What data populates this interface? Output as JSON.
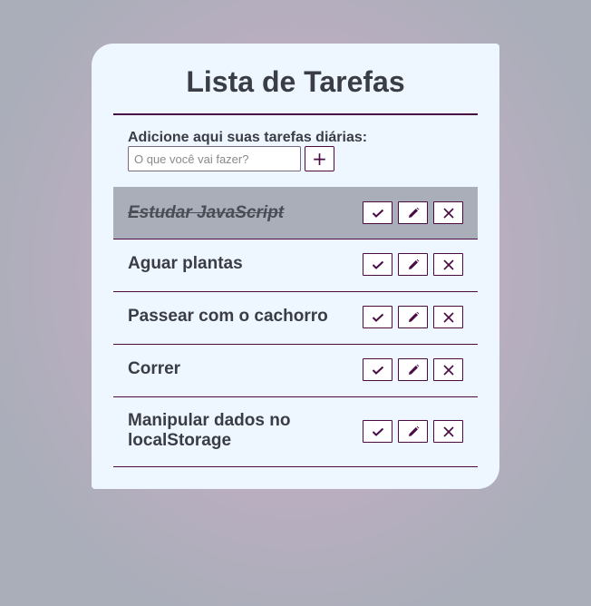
{
  "app": {
    "title": "Lista de Tarefas"
  },
  "form": {
    "label": "Adicione aqui suas tarefas diárias:",
    "input_placeholder": "O que você vai fazer?",
    "input_value": "",
    "add_button_label": "+"
  },
  "tasks": [
    {
      "text": "Estudar JavaScript",
      "done": true
    },
    {
      "text": "Aguar plantas",
      "done": false
    },
    {
      "text": "Passear com o cachorro",
      "done": false
    },
    {
      "text": "Correr",
      "done": false
    },
    {
      "text": "Manipular dados no localStorage",
      "done": false
    }
  ],
  "icons": {
    "complete": "check-icon",
    "edit": "pencil-icon",
    "delete": "close-icon"
  },
  "colors": {
    "accent": "#4a0a44",
    "card_background": "#eef6ff",
    "done_row_background": "#a9aeb9",
    "text": "#3a3d44"
  }
}
